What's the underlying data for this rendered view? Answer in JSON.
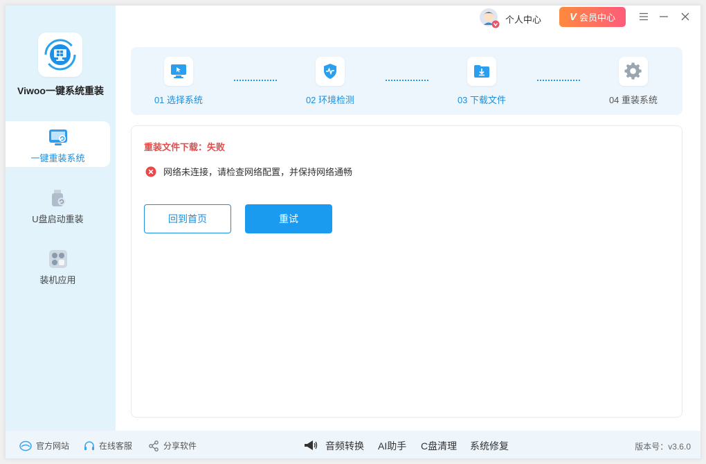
{
  "app": {
    "name": "Viwoo一键系统重装"
  },
  "header": {
    "profile_label": "个人中心",
    "vip_label": "会员中心"
  },
  "sidebar": {
    "items": [
      {
        "label": "一键重装系统",
        "active": true
      },
      {
        "label": "U盘启动重装",
        "active": false
      },
      {
        "label": "装机应用",
        "active": false
      }
    ]
  },
  "steps": [
    {
      "label": "01 选择系统",
      "state": "done"
    },
    {
      "label": "02 环境检测",
      "state": "done"
    },
    {
      "label": "03 下载文件",
      "state": "done"
    },
    {
      "label": "04 重装系统",
      "state": "pending"
    }
  ],
  "status": {
    "title": "重装文件下载：失败",
    "error_message": "网络未连接，请检查网络配置，并保持网络通畅"
  },
  "buttons": {
    "home": "回到首页",
    "retry": "重试"
  },
  "footer": {
    "links": [
      "官方网站",
      "在线客服",
      "分享软件"
    ],
    "tools": [
      "音频转换",
      "AI助手",
      "C盘清理",
      "系统修复"
    ],
    "version": "版本号：v3.6.0"
  },
  "colors": {
    "accent": "#1a9bf0",
    "error": "#e34b4b",
    "sidebar_bg": "#e2f3fb",
    "vip_start": "#ff8a3d",
    "vip_end": "#ff5b7c"
  }
}
